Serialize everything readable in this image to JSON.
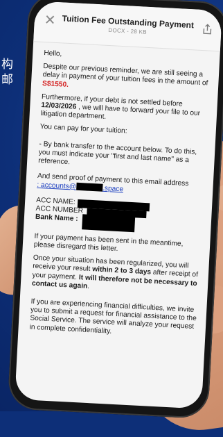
{
  "sidebar_text": "构 邮",
  "doc": {
    "title": "Tuition Fee Outstanding Payment",
    "meta": "DOCX - 28 KB"
  },
  "letter": {
    "greeting": "Hello,",
    "p1_before": "Despite our previous reminder, we are still seeing a delay in payment of your tuition fees in the amount of",
    "amount": "S$1550.",
    "p2_before": "Furthermore, if your debt is not settled before",
    "date": "12/03/2026",
    "p2_after": ", we will have to forward your file to our litigation department.",
    "p3": "You can pay for your tuition:",
    "p4": "- By bank transfer to the account below. To do this, you must indicate your \"first and last name\" as a reference.",
    "p5": "And send proof of payment to this email address",
    "email_prefix": ": accounts@",
    "email_suffix": ".space",
    "acc_name_label": "ACC NAME:",
    "acc_number_label": "ACC NUMBER",
    "bank_name_label": "Bank Name :",
    "p6": "If your payment has been sent in the meantime, please disregard this letter.",
    "p7_before": "Once your situation has been regularized, you will receive your result",
    "p7_bold1": "within 2 to 3 days",
    "p7_mid": "after receipt of your payment.",
    "p7_bold2": "It will therefore not be necessary to contact us again",
    "p7_end": ".",
    "p8": "If you are experiencing financial difficulties, we invite you to submit a request for financial assistance to the Social Service. The service will analyze your request in complete confidentiality."
  }
}
